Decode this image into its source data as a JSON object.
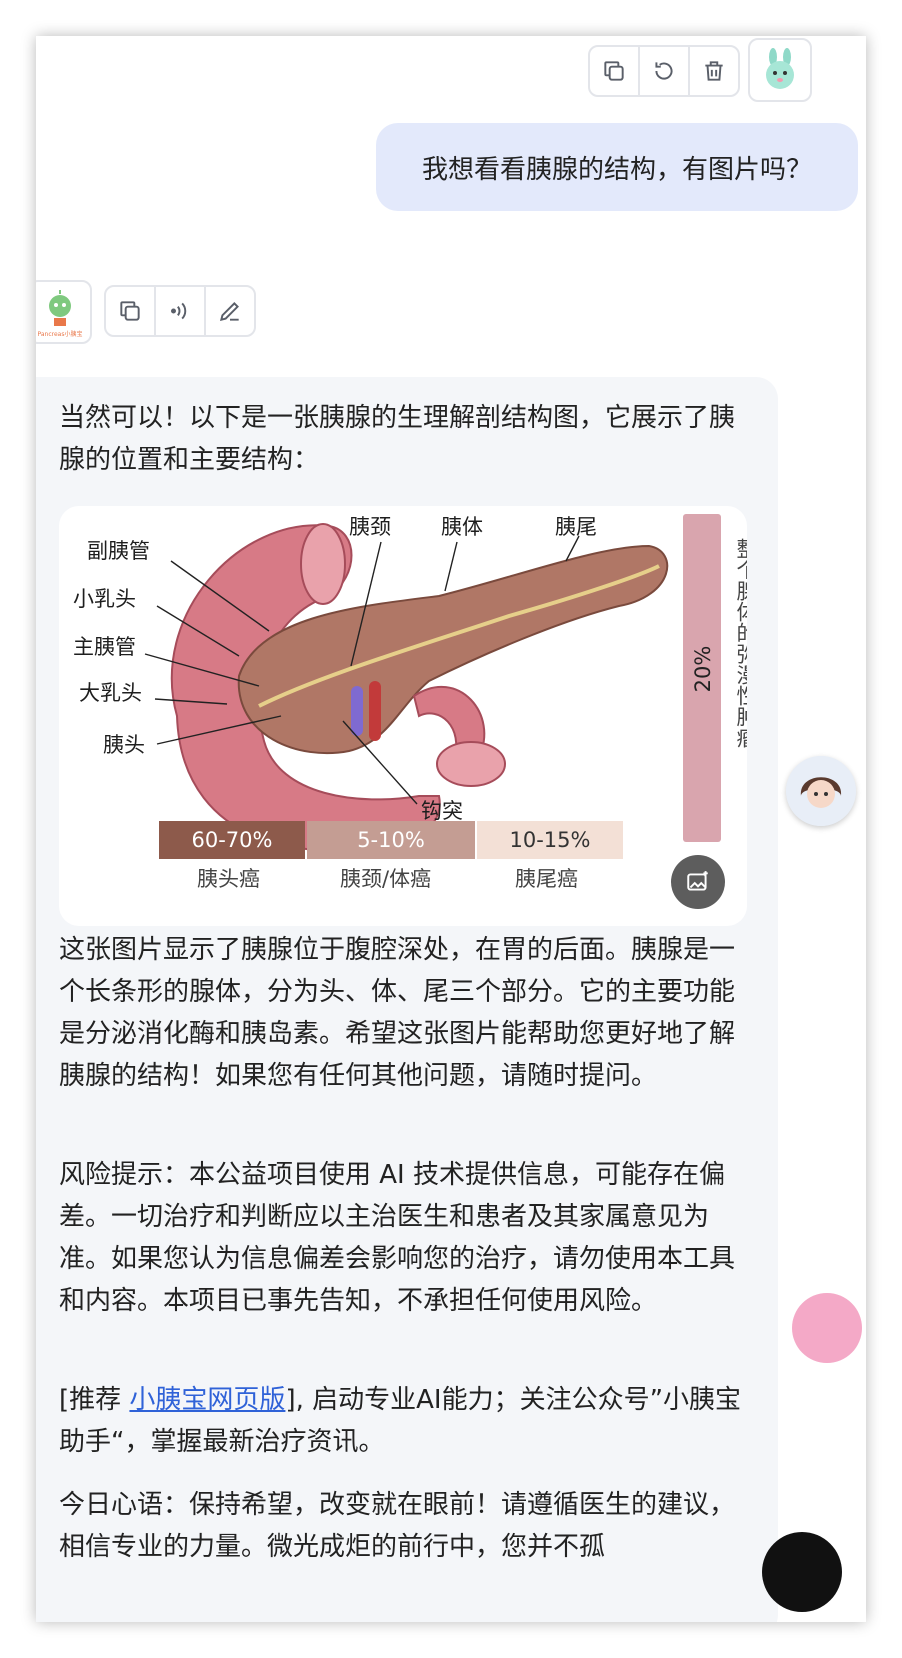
{
  "user_message": {
    "text": "我想看看胰腺的结构，有图片吗？"
  },
  "bot_message": {
    "intro": "当然可以！以下是一张胰腺的生理解剖结构图，它展示了胰腺的位置和主要结构：",
    "figure": {
      "labels_left": [
        "副胰管",
        "小乳头",
        "主胰管",
        "大乳头",
        "胰头"
      ],
      "labels_top": [
        "胰颈",
        "胰体",
        "胰尾"
      ],
      "label_bottom": "钩突",
      "vertical_pct": "20%",
      "vertical_text": "整个腺体的弥漫性肿瘤",
      "pct_head": "60-70%",
      "pct_neck": "5-10%",
      "pct_tail": "10-15%",
      "cat_head": "胰头癌",
      "cat_neck": "胰颈/体癌",
      "cat_tail": "胰尾癌",
      "colors": {
        "head": "#8d5a4b",
        "neck": "#c49d93",
        "tail": "#f3e0d6",
        "vertical": "#d9a5ae"
      }
    },
    "para1": "这张图片显示了胰腺位于腹腔深处，在胃的后面。胰腺是一个长条形的腺体，分为头、体、尾三个部分。它的主要功能是分泌消化酶和胰岛素。希望这张图片能帮助您更好地了解胰腺的结构！如果您有任何其他问题，请随时提问。",
    "para2": "风险提示：本公益项目使用 AI 技术提供信息，可能存在偏差。一切治疗和判断应以主治医生和患者及其家属意见为准。如果您认为信息偏差会影响您的治疗，请勿使用本工具和内容。本项目已事先告知，不承担任何使用风险。",
    "para3_prefix": "[推荐 ",
    "para3_link": "小胰宝网页版",
    "para3_suffix": "], 启动专业AI能力；关注公众号”小胰宝助手“，掌握最新治疗资讯。",
    "para4": "今日心语：保持希望，改变就在眼前！请遵循医生的建议，相信专业的力量。微光成炬的前行中，您并不孤"
  },
  "bot_avatar": {
    "caption": "Pancreas小胰宝"
  },
  "icons": {
    "user_toolbar": [
      "copy-icon",
      "refresh-icon",
      "trash-icon"
    ],
    "bot_toolbar": [
      "copy-icon",
      "speaker-icon",
      "edit-icon"
    ]
  }
}
